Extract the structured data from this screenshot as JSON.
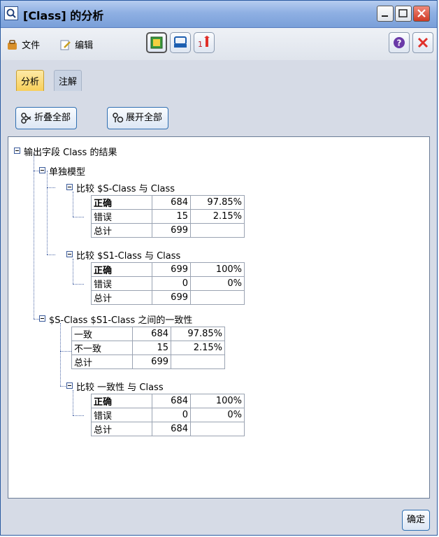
{
  "window": {
    "title": "[Class] 的分析"
  },
  "icons": {
    "app": "search-magnifier-icon",
    "file": "file-bag-icon",
    "edit": "edit-pencil-icon",
    "help": "help-question-icon",
    "close": "close-x-icon"
  },
  "menu": {
    "file": "文件",
    "edit": "编辑"
  },
  "tabs": [
    {
      "label": "分析"
    },
    {
      "label": "注解"
    }
  ],
  "actions": {
    "collapse_all": "折叠全部",
    "expand_all": "展开全部"
  },
  "tree": {
    "root": "输出字段 Class 的结果",
    "single_model": "单独模型",
    "cmp1": {
      "title": "比较 $S-Class 与 Class",
      "rows": [
        {
          "label": "正确",
          "count": "684",
          "pct": "97.85%"
        },
        {
          "label": "错误",
          "count": "15",
          "pct": "2.15%"
        },
        {
          "label": "总计",
          "count": "699",
          "pct": ""
        }
      ]
    },
    "cmp2": {
      "title": "比较 $S1-Class 与 Class",
      "rows": [
        {
          "label": "正确",
          "count": "699",
          "pct": "100%"
        },
        {
          "label": "错误",
          "count": "0",
          "pct": "0%"
        },
        {
          "label": "总计",
          "count": "699",
          "pct": ""
        }
      ]
    },
    "agreement": {
      "title": "$S-Class $S1-Class 之间的一致性",
      "rows": [
        {
          "label": "一致",
          "count": "684",
          "pct": "97.85%"
        },
        {
          "label": "不一致",
          "count": "15",
          "pct": "2.15%"
        },
        {
          "label": "总计",
          "count": "699",
          "pct": ""
        }
      ]
    },
    "cmp3": {
      "title": "比较 一致性 与 Class",
      "rows": [
        {
          "label": "正确",
          "count": "684",
          "pct": "100%"
        },
        {
          "label": "错误",
          "count": "0",
          "pct": "0%"
        },
        {
          "label": "总计",
          "count": "684",
          "pct": ""
        }
      ]
    }
  },
  "footer": {
    "ok": "确定"
  }
}
